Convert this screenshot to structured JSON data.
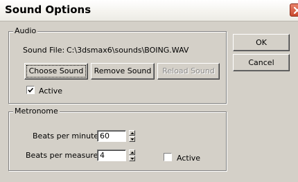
{
  "window": {
    "title": "Sound Options"
  },
  "audio": {
    "group_label": "Audio",
    "sound_file_label": "Sound File:",
    "sound_file_path": "C:\\3dsmax6\\sounds\\BOING.WAV",
    "choose_sound_label": "Choose Sound",
    "remove_sound_label": "Remove Sound",
    "reload_sound_label": "Reload Sound",
    "active_label": "Active",
    "active_checked": true
  },
  "metronome": {
    "group_label": "Metronome",
    "beats_per_minute_label": "Beats per minute:",
    "beats_per_minute_value": "60",
    "beats_per_measure_label": "Beats per measure:",
    "beats_per_measure_value": "4",
    "active_label": "Active",
    "active_checked": false
  },
  "buttons": {
    "ok_label": "OK",
    "cancel_label": "Cancel"
  },
  "icons": {
    "close": "close-icon",
    "check": "checkmark-icon",
    "spin_up": "spin-up-arrow-icon",
    "spin_down": "spin-down-arrow-icon"
  }
}
